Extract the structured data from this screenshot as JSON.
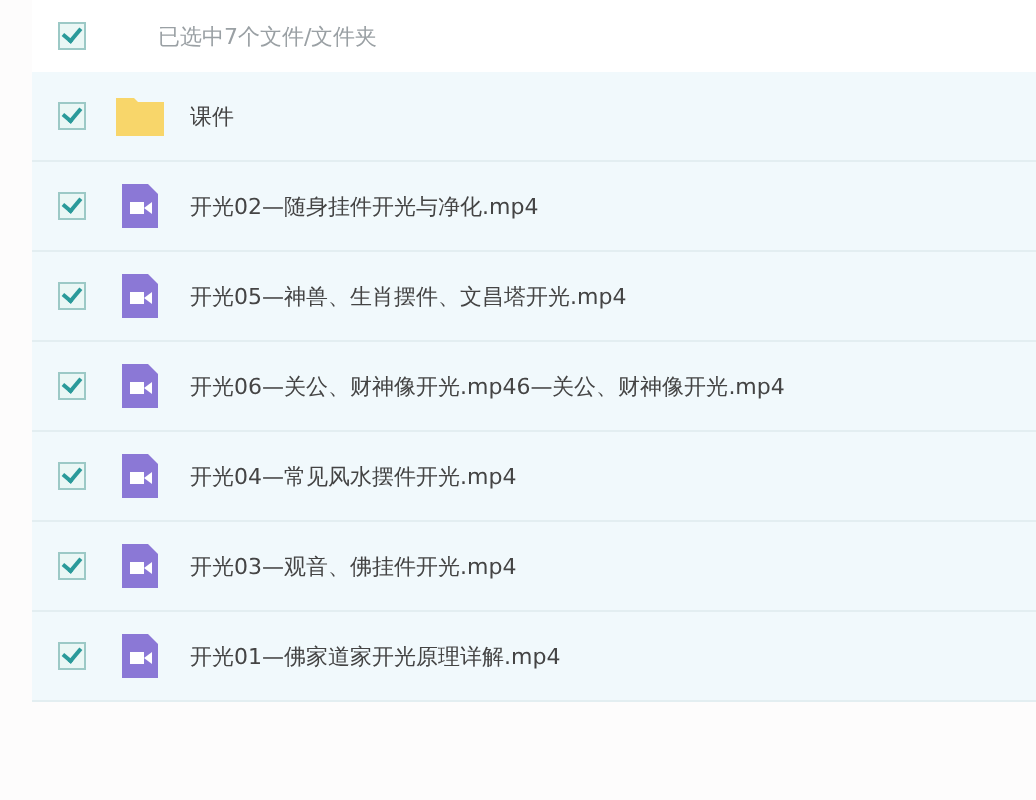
{
  "header": {
    "checked": true,
    "summary": "已选中7个文件/文件夹"
  },
  "files": [
    {
      "kind": "folder",
      "name": "课件",
      "checked": true,
      "selected": true
    },
    {
      "kind": "video",
      "name": "开光02—随身挂件开光与净化.mp4",
      "checked": true,
      "selected": true
    },
    {
      "kind": "video",
      "name": "开光05—神兽、生肖摆件、文昌塔开光.mp4",
      "checked": true,
      "selected": true
    },
    {
      "kind": "video",
      "name": "开光06—关公、财神像开光.mp46—关公、财神像开光.mp4",
      "checked": true,
      "selected": true
    },
    {
      "kind": "video",
      "name": "开光04—常见风水摆件开光.mp4",
      "checked": true,
      "selected": true
    },
    {
      "kind": "video",
      "name": "开光03—观音、佛挂件开光.mp4",
      "checked": true,
      "selected": true
    },
    {
      "kind": "video",
      "name": "开光01—佛家道家开光原理详解.mp4",
      "checked": true,
      "selected": true
    }
  ]
}
